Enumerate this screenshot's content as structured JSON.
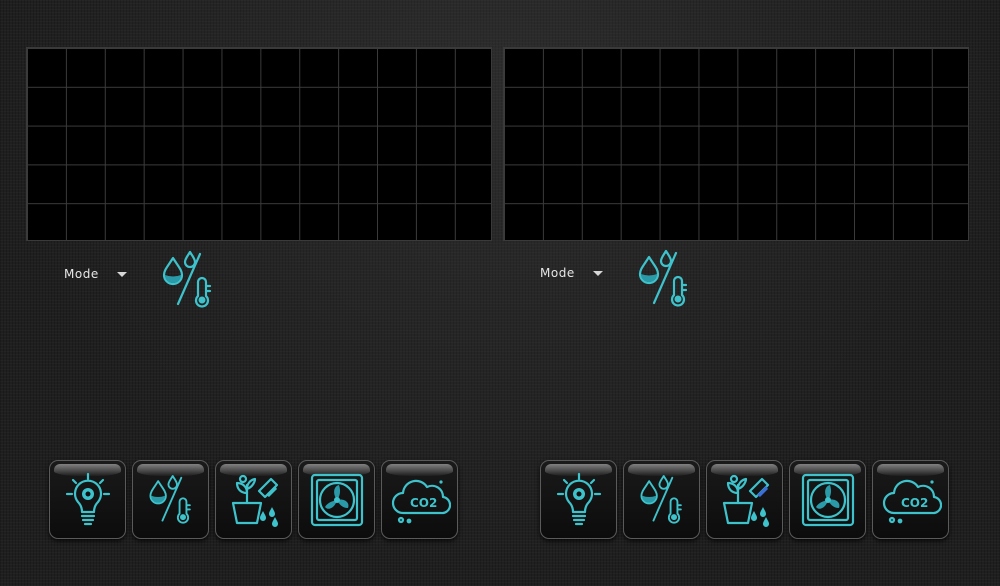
{
  "panels": [
    {
      "mode": {
        "label": "Mode"
      }
    },
    {
      "mode": {
        "label": "Mode"
      }
    }
  ],
  "colors": {
    "accent": "#3ec3cc",
    "background": "#1f1f1f",
    "grid": "#3b3b3b"
  },
  "dock": {
    "buttons": [
      {
        "icon": "light-bulb-gear-icon"
      },
      {
        "icon": "humidity-temperature-icon"
      },
      {
        "icon": "plant-watering-icon"
      },
      {
        "icon": "fan-icon"
      },
      {
        "icon": "co2-cloud-icon"
      }
    ],
    "co2_text": "CO2"
  }
}
